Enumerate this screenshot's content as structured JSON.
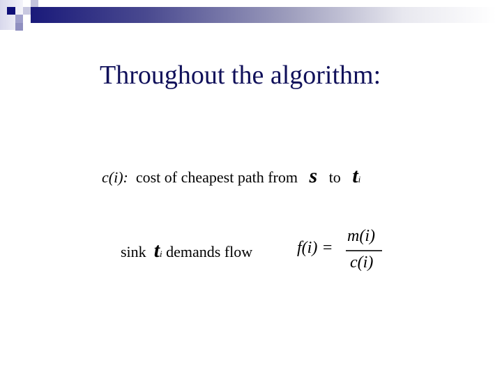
{
  "header": {
    "accent_color": "#1a1a7a"
  },
  "slide": {
    "title": "Throughout the algorithm:",
    "definition": {
      "term": "c(i):",
      "text": "cost of cheapest path from",
      "source_symbol": "s",
      "connector": "to",
      "target_symbol": "t",
      "target_subscript": "i"
    },
    "demand": {
      "prefix": "sink",
      "symbol": "t",
      "subscript": "i",
      "text": "demands flow",
      "formula_lhs": "f(i) =",
      "formula_numerator": "m(i)",
      "formula_denominator": "c(i)"
    }
  }
}
